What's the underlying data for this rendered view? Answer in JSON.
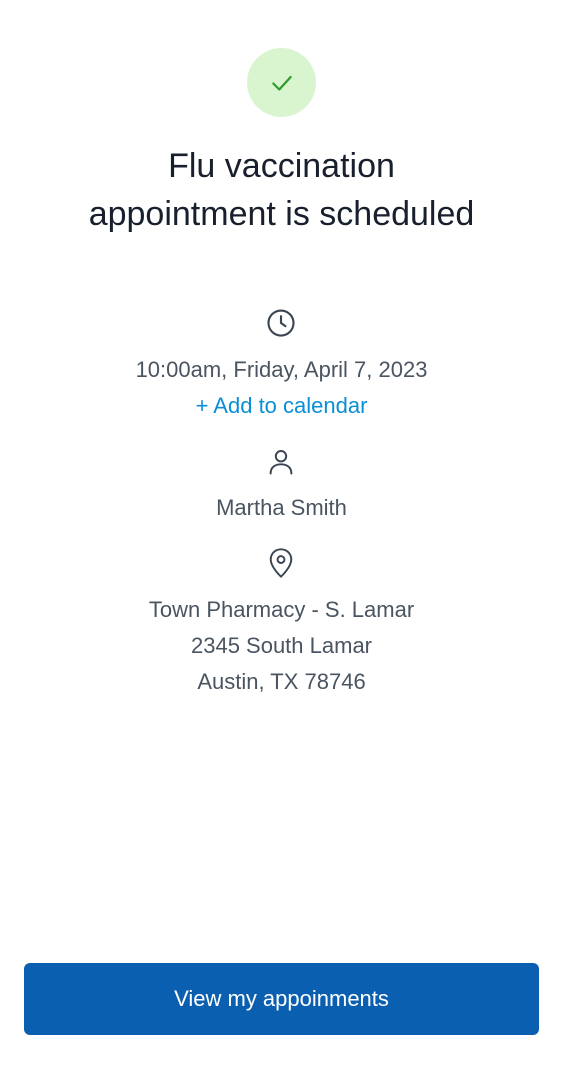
{
  "status": {
    "icon": "checkmark-icon",
    "title_line1": "Flu vaccination",
    "title_line2": "appointment is scheduled",
    "colors": {
      "badge_bg": "#d8f5d0",
      "check": "#2f9a2a"
    }
  },
  "appointment": {
    "time_icon": "clock-icon",
    "datetime": "10:00am, Friday, April 7, 2023",
    "add_to_calendar": "+ Add to calendar",
    "person_icon": "person-icon",
    "patient_name": "Martha Smith",
    "location_icon": "location-pin-icon",
    "location_name": "Town Pharmacy - S. Lamar",
    "address_line1": "2345 South Lamar",
    "address_line2": "Austin, TX 78746"
  },
  "actions": {
    "view_appointments_label": "View my appoinments",
    "primary_color": "#0a5fb0",
    "link_color": "#0a8fd6"
  }
}
